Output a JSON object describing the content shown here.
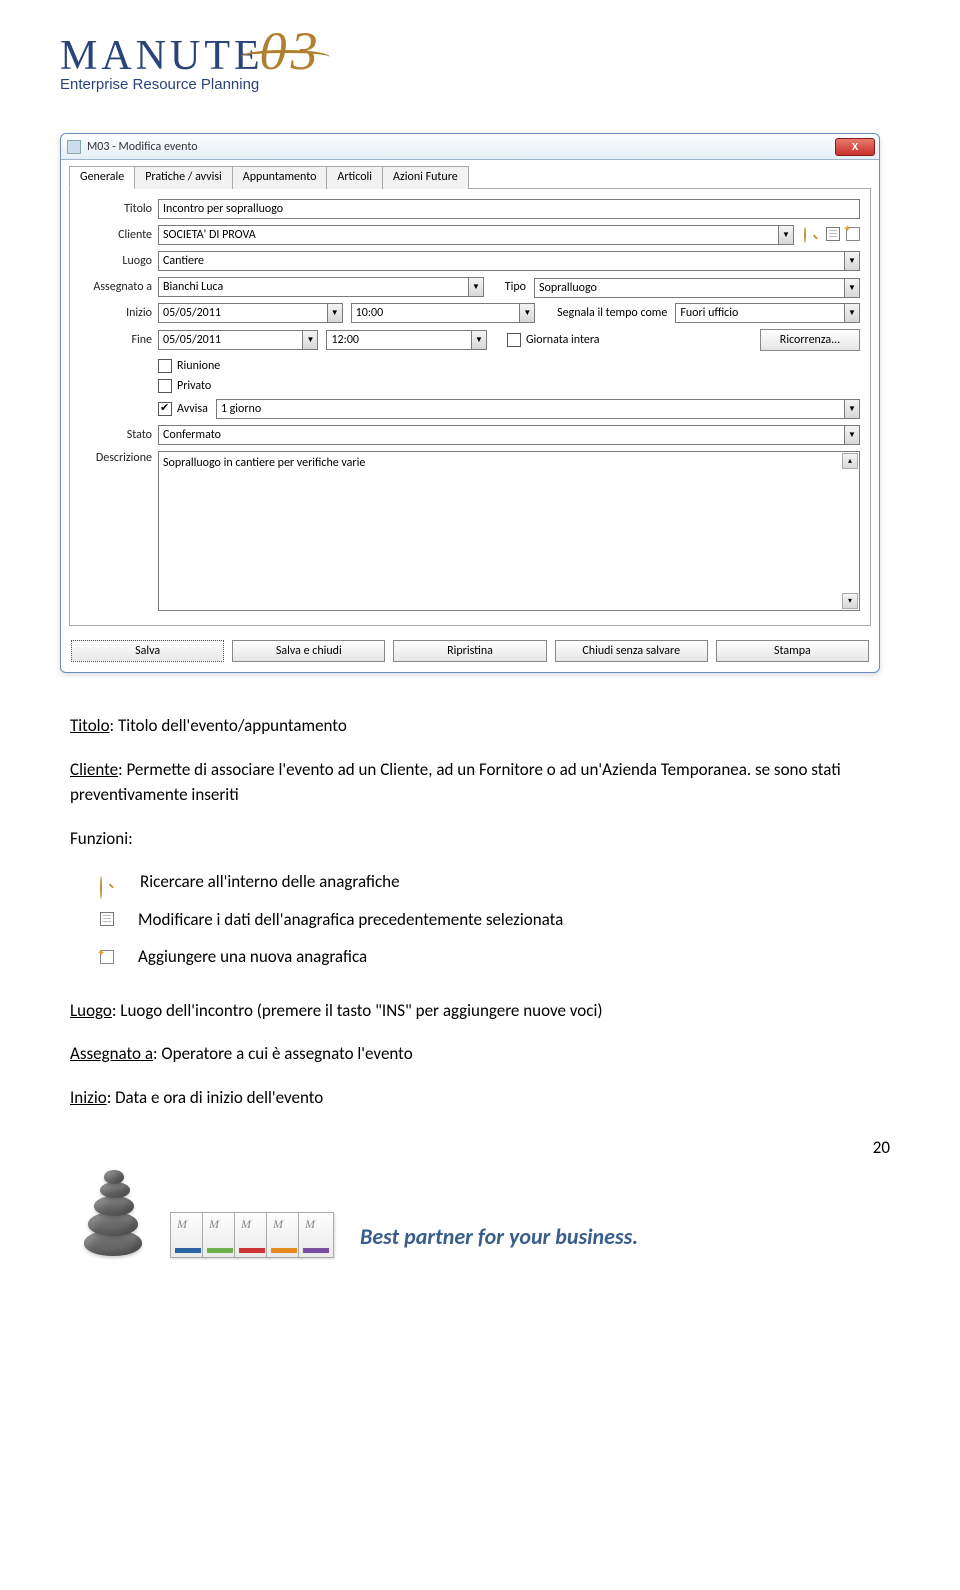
{
  "logo": {
    "brand_main": "MANUTE",
    "brand_accent": "03",
    "tagline": "Enterprise Resource Planning"
  },
  "dialog": {
    "title": "M03 - Modifica evento",
    "close_glyph": "X",
    "tabs": [
      "Generale",
      "Pratiche / avvisi",
      "Appuntamento",
      "Articoli",
      "Azioni Future"
    ],
    "labels": {
      "titolo": "Titolo",
      "cliente": "Cliente",
      "luogo": "Luogo",
      "assegnato": "Assegnato a",
      "tipo": "Tipo",
      "inizio": "Inizio",
      "segnala": "Segnala il tempo come",
      "fine": "Fine",
      "giornata": "Giornata intera",
      "ricorrenza": "Ricorrenza...",
      "riunione": "Riunione",
      "privato": "Privato",
      "avvisa": "Avvisa",
      "stato": "Stato",
      "descrizione": "Descrizione"
    },
    "values": {
      "titolo": "Incontro per sopralluogo",
      "cliente": "SOCIETA' DI PROVA",
      "luogo": "Cantiere",
      "assegnato": "Bianchi Luca",
      "tipo": "Sopralluogo",
      "inizio_data": "05/05/2011",
      "inizio_ora": "10:00",
      "segnala": "Fuori ufficio",
      "fine_data": "05/05/2011",
      "fine_ora": "12:00",
      "avvisa_val": "1 giorno",
      "stato": "Confermato",
      "descrizione": "Sopralluogo in cantiere per verifiche varie"
    },
    "checks": {
      "giornata": false,
      "riunione": false,
      "privato": false,
      "avvisa": true
    },
    "buttons": {
      "salva": "Salva",
      "salva_chiudi": "Salva e chiudi",
      "ripristina": "Ripristina",
      "chiudi": "Chiudi senza salvare",
      "stampa": "Stampa"
    }
  },
  "body_text": {
    "titolo_lbl": "Titolo",
    "titolo_txt": ": Titolo dell'evento/appuntamento",
    "cliente_lbl": "Cliente",
    "cliente_txt": ": Permette di associare l'evento ad un Cliente, ad un Fornitore o ad un'Azienda Temporanea. se sono stati preventivamente inseriti",
    "funzioni": "Funzioni:",
    "f1": "Ricercare all'interno delle anagrafiche",
    "f2": "Modificare i dati dell'anagrafica precedentemente selezionata",
    "f3": "Aggiungere una nuova anagrafica",
    "luogo_lbl": "Luogo",
    "luogo_txt": ":  Luogo dell'incontro (premere il tasto \"INS\" per aggiungere nuove voci)",
    "assegnato_lbl": "Assegnato a",
    "assegnato_txt": ": Operatore a cui è assegnato l'evento",
    "inizio_lbl": "Inizio",
    "inizio_txt": ": Data e ora di inizio dell'evento"
  },
  "footer": {
    "tagline": "Best partner for your business.",
    "page": "20"
  }
}
